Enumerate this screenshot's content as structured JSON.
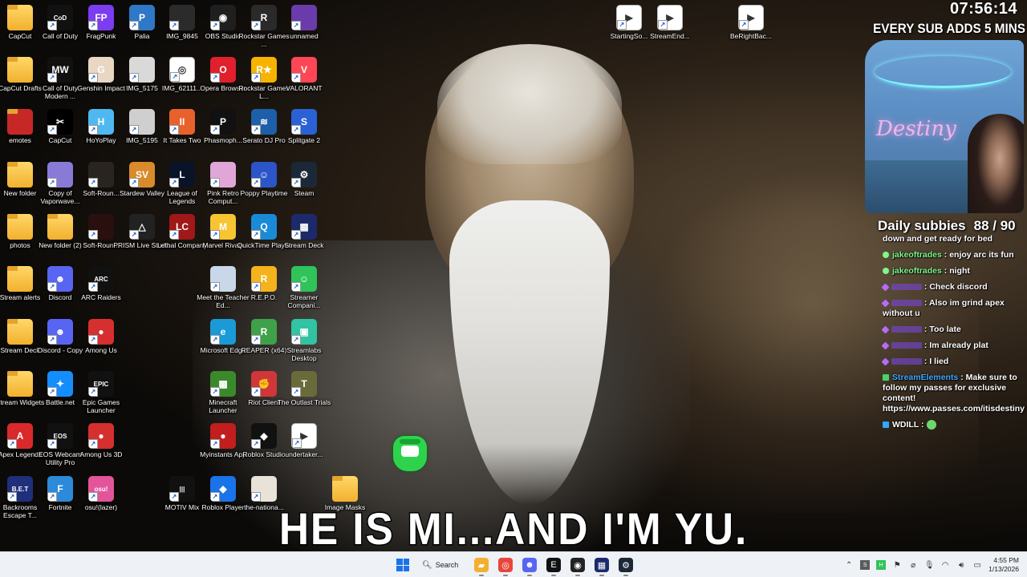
{
  "wallpaper": {
    "subtitle": "HE IS MI...AND I'M YU."
  },
  "desktop_icons": [
    {
      "label": "CapCut",
      "icon": "folder-icon",
      "color": "#f2b02e"
    },
    {
      "label": "Call of Duty",
      "icon": "call-of-duty-icon",
      "color": "#111111"
    },
    {
      "label": "FragPunk",
      "icon": "fragpunk-icon",
      "color": "#7c3cf0"
    },
    {
      "label": "Palia",
      "icon": "palia-icon",
      "color": "#2e78c7"
    },
    {
      "label": "IMG_9845",
      "icon": "image-file-icon",
      "color": "#2b2b2b"
    },
    {
      "label": "OBS Studio",
      "icon": "obs-icon",
      "color": "#1f1f1f"
    },
    {
      "label": "Rockstar Games ...",
      "icon": "rockstar-icon",
      "color": "#2a2a2a"
    },
    {
      "label": "unnamed",
      "icon": "image-file-icon",
      "color": "#6a3cab"
    },
    {
      "label": "CapCut Drafts",
      "icon": "folder-icon",
      "color": "#f2b02e"
    },
    {
      "label": "Call of Duty Modern ...",
      "icon": "modern-warfare-icon",
      "color": "#111111"
    },
    {
      "label": "Genshin Impact",
      "icon": "genshin-icon",
      "color": "#e9d6c3"
    },
    {
      "label": "IMG_5175",
      "icon": "image-file-icon",
      "color": "#d9d9d9"
    },
    {
      "label": "IMG_62111...",
      "icon": "chrome-file-icon",
      "color": "#ffffff"
    },
    {
      "label": "Opera Browser",
      "icon": "opera-icon",
      "color": "#e0202d"
    },
    {
      "label": "Rockstar Games L...",
      "icon": "rockstar-launcher-icon",
      "color": "#f6b400"
    },
    {
      "label": "VALORANT",
      "icon": "valorant-icon",
      "color": "#ff4655"
    },
    {
      "label": "emotes",
      "icon": "folder-icon",
      "color": "#c62828"
    },
    {
      "label": "CapCut",
      "icon": "capcut-icon",
      "color": "#000000"
    },
    {
      "label": "HoYoPlay",
      "icon": "hoyoplay-icon",
      "color": "#4fb8f0"
    },
    {
      "label": "IMG_5195",
      "icon": "image-file-icon",
      "color": "#cfcfcf"
    },
    {
      "label": "It Takes Two",
      "icon": "it-takes-two-icon",
      "color": "#e8612c"
    },
    {
      "label": "Phasmoph...",
      "icon": "phasmophobia-icon",
      "color": "#111111"
    },
    {
      "label": "Serato DJ Pro",
      "icon": "serato-icon",
      "color": "#1d5fa8"
    },
    {
      "label": "Splitgate 2",
      "icon": "splitgate-icon",
      "color": "#2a62d6"
    },
    {
      "label": "New folder",
      "icon": "folder-icon",
      "color": "#f2b02e"
    },
    {
      "label": "Copy of Vaporwave...",
      "icon": "image-file-icon",
      "color": "#8a7ad8"
    },
    {
      "label": "Soft-Roun...",
      "icon": "image-file-icon",
      "color": "#2a2420"
    },
    {
      "label": "Stardew Valley",
      "icon": "stardew-icon",
      "color": "#d98a2b"
    },
    {
      "label": "League of Legends",
      "icon": "league-icon",
      "color": "#0a1428"
    },
    {
      "label": "Pink Retro Comput...",
      "icon": "image-file-icon",
      "color": "#e0a6d8"
    },
    {
      "label": "Poppy Playtime",
      "icon": "poppy-icon",
      "color": "#2b55c8"
    },
    {
      "label": "Steam",
      "icon": "steam-icon",
      "color": "#1b2838"
    },
    {
      "label": "photos",
      "icon": "folder-icon",
      "color": "#f2b02e"
    },
    {
      "label": "New folder (2)",
      "icon": "folder-icon",
      "color": "#f2b02e"
    },
    {
      "label": "Soft-Roun...",
      "icon": "image-file-icon",
      "color": "#2a0f0f"
    },
    {
      "label": "PRISM Live Studio",
      "icon": "prism-icon",
      "color": "#222222"
    },
    {
      "label": "Lethal Company",
      "icon": "lethal-company-icon",
      "color": "#a01818"
    },
    {
      "label": "Marvel Rivals",
      "icon": "marvel-rivals-icon",
      "color": "#f6c531"
    },
    {
      "label": "QuickTime Player",
      "icon": "quicktime-icon",
      "color": "#1a8ad6"
    },
    {
      "label": "Stream Deck",
      "icon": "stream-deck-icon",
      "color": "#1c2a6b"
    },
    {
      "label": "Stream alerts",
      "icon": "folder-icon",
      "color": "#f2b02e"
    },
    {
      "label": "Discord",
      "icon": "discord-icon",
      "color": "#5865f2"
    },
    {
      "label": "ARC Raiders",
      "icon": "arc-raiders-icon",
      "color": "#111111"
    },
    {
      "label": "Meet the Teacher Ed...",
      "icon": "image-file-icon",
      "color": "#c8d8e8"
    },
    {
      "label": "R.E.P.O.",
      "icon": "repo-icon",
      "color": "#f4b31c"
    },
    {
      "label": "Streamer Compani...",
      "icon": "streamer-companion-icon",
      "color": "#2fc35a"
    },
    {
      "label": "Stream Deck",
      "icon": "folder-icon",
      "color": "#f2b02e"
    },
    {
      "label": "Discord - Copy",
      "icon": "discord-icon",
      "color": "#5865f2"
    },
    {
      "label": "Among Us",
      "icon": "among-us-icon",
      "color": "#d62f2f"
    },
    {
      "label": "Microsoft Edge",
      "icon": "edge-icon",
      "color": "#1a9ad6"
    },
    {
      "label": "REAPER (x64)",
      "icon": "reaper-icon",
      "color": "#3fa14a"
    },
    {
      "label": "Streamlabs Desktop",
      "icon": "streamlabs-icon",
      "color": "#31c3a2"
    },
    {
      "label": "Stream Widgets",
      "icon": "folder-icon",
      "color": "#f2b02e"
    },
    {
      "label": "Battle.net",
      "icon": "battlenet-icon",
      "color": "#148eff"
    },
    {
      "label": "Epic Games Launcher",
      "icon": "epic-games-icon",
      "color": "#111111"
    },
    {
      "label": "Minecraft Launcher",
      "icon": "minecraft-icon",
      "color": "#3a8a2c"
    },
    {
      "label": "Riot Client",
      "icon": "riot-icon",
      "color": "#d13639"
    },
    {
      "label": "The Outlast Trials",
      "icon": "outlast-icon",
      "color": "#6b6a3a"
    },
    {
      "label": "Apex Legends",
      "icon": "apex-icon",
      "color": "#da292a"
    },
    {
      "label": "EOS Webcam Utility Pro",
      "icon": "eos-webcam-icon",
      "color": "#111111"
    },
    {
      "label": "Among Us 3D",
      "icon": "among-us-icon",
      "color": "#d62f2f"
    },
    {
      "label": "Myinstants App",
      "icon": "myinstants-icon",
      "color": "#c21e1e"
    },
    {
      "label": "Roblox Studio",
      "icon": "roblox-studio-icon",
      "color": "#111111"
    },
    {
      "label": "undertaker...",
      "icon": "video-file-icon",
      "color": "#ffffff"
    },
    {
      "label": "Backrooms Escape T...",
      "icon": "backrooms-icon",
      "color": "#1f2f7a"
    },
    {
      "label": "Fortnite",
      "icon": "fortnite-icon",
      "color": "#2c8ad8"
    },
    {
      "label": "osu!(lazer)",
      "icon": "osu-icon",
      "color": "#e2559a"
    },
    {
      "label": "MOTIV Mix",
      "icon": "motiv-mix-icon",
      "color": "#111111"
    },
    {
      "label": "Roblox Player",
      "icon": "roblox-icon",
      "color": "#1a73e8"
    },
    {
      "label": "the-nationa...",
      "icon": "image-file-icon",
      "color": "#e8e2d8"
    },
    {
      "label": "Image Masks",
      "icon": "folder-icon",
      "color": "#f2b02e"
    },
    {
      "label": "StartingSo...",
      "icon": "video-file-icon",
      "color": "#ffffff"
    },
    {
      "label": "StreamEnd...",
      "icon": "video-file-icon",
      "color": "#ffffff"
    },
    {
      "label": "BeRightBac...",
      "icon": "video-file-icon",
      "color": "#ffffff"
    }
  ],
  "overlay": {
    "clock": "07:56:14",
    "sub_goal": "EVERY SUB ADDS 5 MINS",
    "webcam_sign": "Destiny",
    "subbies_label": "Daily subbies",
    "subbies_count": "88 / 90"
  },
  "chat": [
    {
      "badge": "",
      "user": "",
      "user_color": "",
      "text": "down and get ready for bed"
    },
    {
      "badge": "viewer",
      "user": "jakeoftrades",
      "user_color": "green",
      "text": ": enjoy arc its fun"
    },
    {
      "badge": "viewer",
      "user": "jakeoftrades",
      "user_color": "green",
      "text": ": night"
    },
    {
      "badge": "sub",
      "user": "",
      "user_color": "purple",
      "text": ": Check discord"
    },
    {
      "badge": "sub",
      "user": "",
      "user_color": "purple",
      "text": ": Also im grind apex without u"
    },
    {
      "badge": "sub",
      "user": "",
      "user_color": "purple",
      "text": ": Too late"
    },
    {
      "badge": "sub",
      "user": "",
      "user_color": "purple",
      "text": ": Im already plat"
    },
    {
      "badge": "sub",
      "user": "",
      "user_color": "purple",
      "text": ": I lied"
    },
    {
      "badge": "mod",
      "user": "StreamElements",
      "user_color": "blue",
      "text": ": Make sure to follow my passes for exclusive content! https://www.passes.com/itisdestiny"
    },
    {
      "badge": "vip",
      "user": "WDILL",
      "user_color": "white",
      "text": ":"
    }
  ],
  "taskbar": {
    "search_label": "Search",
    "apps": [
      "file-explorer-icon",
      "chrome-icon",
      "discord-icon",
      "epic-games-icon",
      "obs-icon",
      "stream-deck-icon",
      "steam-icon"
    ],
    "time": "4:55 PM",
    "date": "1/13/2026"
  }
}
